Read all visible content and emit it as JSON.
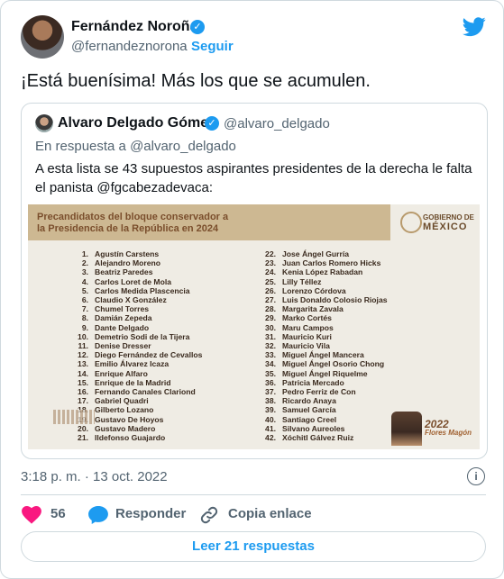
{
  "author": {
    "name": "Fernández Noroña",
    "handle": "@fernandeznorona",
    "separator": "·",
    "follow_label": "Seguir"
  },
  "tweet_text": "¡Está buenísima! Más los que se acumulen.",
  "quoted": {
    "name": "Alvaro Delgado Gómez",
    "handle": "@alvaro_delgado",
    "reply_to": "En respuesta a @alvaro_delgado",
    "text": "A esta lista se 43 supuestos aspirantes presidentes de la derecha le falta el panista  @fgcabezadevaca:",
    "image": {
      "title_line1": "Precandidatos del bloque conservador a",
      "title_line2": "la Presidencia de la República en 2024",
      "gov_label1": "GOBIERNO DE",
      "gov_label2": "MÉXICO",
      "logo_year": "2022",
      "logo_name": "Flores Magón",
      "col1": [
        [
          "1.",
          "Agustín Carstens"
        ],
        [
          "2.",
          "Alejandro Moreno"
        ],
        [
          "3.",
          "Beatriz Paredes"
        ],
        [
          "4.",
          "Carlos Loret de Mola"
        ],
        [
          "5.",
          "Carlos Medida Plascencia"
        ],
        [
          "6.",
          "Claudio X González"
        ],
        [
          "7.",
          "Chumel Torres"
        ],
        [
          "8.",
          "Damián Zepeda"
        ],
        [
          "9.",
          "Dante Delgado"
        ],
        [
          "10.",
          "Demetrio Sodi de la Tijera"
        ],
        [
          "11.",
          "Denise Dresser"
        ],
        [
          "12.",
          "Diego Fernández de Cevallos"
        ],
        [
          "13.",
          "Emilio Álvarez Icaza"
        ],
        [
          "14.",
          "Enrique Alfaro"
        ],
        [
          "15.",
          "Enrique de la Madrid"
        ],
        [
          "16.",
          "Fernando Canales Clariond"
        ],
        [
          "17.",
          "Gabriel Quadri"
        ],
        [
          "18.",
          "Gilberto Lozano"
        ],
        [
          "19.",
          "Gustavo De Hoyos"
        ],
        [
          "20.",
          "Gustavo Madero"
        ],
        [
          "21.",
          "Ildefonso Guajardo"
        ]
      ],
      "col2": [
        [
          "22.",
          "Jose Ángel Gurría"
        ],
        [
          "23.",
          "Juan Carlos Romero Hicks"
        ],
        [
          "24.",
          "Kenia López Rabadan"
        ],
        [
          "25.",
          "Lilly Téllez"
        ],
        [
          "26.",
          "Lorenzo Córdova"
        ],
        [
          "27.",
          "Luis Donaldo Colosio Riojas"
        ],
        [
          "28.",
          "Margarita Zavala"
        ],
        [
          "29.",
          "Marko Cortés"
        ],
        [
          "30.",
          "Maru Campos"
        ],
        [
          "31.",
          "Mauricio Kuri"
        ],
        [
          "32.",
          "Mauricio Vila"
        ],
        [
          "33.",
          "Miguel Ángel Mancera"
        ],
        [
          "34.",
          "Miguel Ángel Osorio Chong"
        ],
        [
          "35.",
          "Miguel Ángel Riquelme"
        ],
        [
          "36.",
          "Patricia Mercado"
        ],
        [
          "37.",
          "Pedro Ferriz de Con"
        ],
        [
          "38.",
          "Ricardo Anaya"
        ],
        [
          "39.",
          "Samuel García"
        ],
        [
          "40.",
          "Santiago Creel"
        ],
        [
          "41.",
          "Silvano Aureoles"
        ],
        [
          "42.",
          "Xóchitl Gálvez Ruiz"
        ]
      ]
    }
  },
  "timestamp": "3:18 p. m. · 13 oct. 2022",
  "info_symbol": "i",
  "actions": {
    "like_count": "56",
    "reply_label": "Responder",
    "copy_label": "Copia enlace"
  },
  "read_replies_label": "Leer 21 respuestas",
  "colors": {
    "accent": "#1d9bf0",
    "heart": "#f91880",
    "muted": "#536471"
  },
  "icons": [
    "twitter-bird-icon",
    "verified-icon",
    "heart-icon",
    "reply-bubble-icon",
    "link-icon",
    "info-icon"
  ]
}
